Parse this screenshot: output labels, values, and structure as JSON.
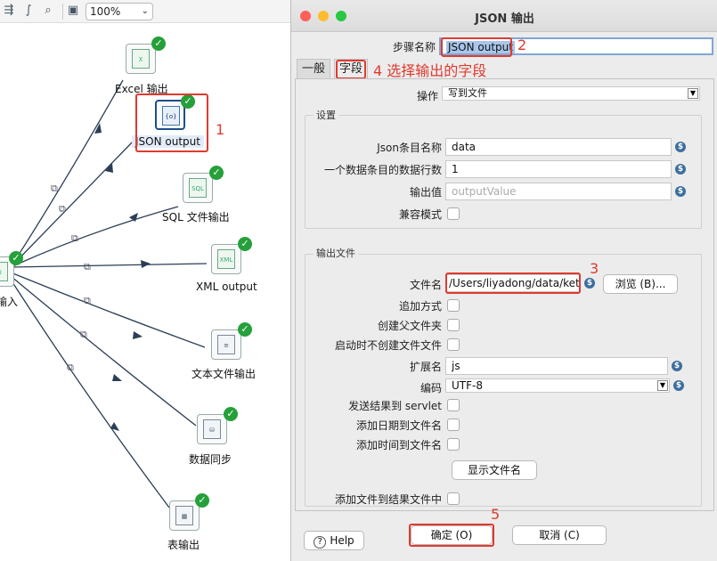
{
  "toolbar": {
    "zoom_value": "100%",
    "icons": [
      "flow-icon",
      "curve-icon",
      "zoom-fit-icon",
      "grid-icon"
    ]
  },
  "canvas": {
    "source_label": "输入",
    "steps": [
      {
        "id": "excel",
        "label": "Excel 输出",
        "icon": "excel-file-icon"
      },
      {
        "id": "json",
        "label": "JSON output",
        "icon": "json-file-icon"
      },
      {
        "id": "sql",
        "label": "SQL 文件输出",
        "icon": "sql-file-icon"
      },
      {
        "id": "xml",
        "label": "XML output",
        "icon": "xml-file-icon"
      },
      {
        "id": "text",
        "label": "文本文件输出",
        "icon": "text-file-icon"
      },
      {
        "id": "sync",
        "label": "数据同步",
        "icon": "database-sync-icon"
      },
      {
        "id": "table",
        "label": "表输出",
        "icon": "table-icon"
      }
    ],
    "annotation_1": "1"
  },
  "dialog": {
    "title": "JSON 输出",
    "step_name_label": "步骤名称",
    "step_name_value": "JSON output",
    "annotation_2": "2",
    "tabs": [
      {
        "label": "一般",
        "active": false
      },
      {
        "label": "字段",
        "active": true
      }
    ],
    "annotation_4": "4 选择输出的字段",
    "operation_label": "操作",
    "operation_value": "写到文件",
    "settings": {
      "group_title": "设置",
      "json_block_label": "Json条目名称",
      "json_block_value": "data",
      "rows_per_block_label": "一个数据条目的数据行数",
      "rows_per_block_value": "1",
      "output_value_label": "输出值",
      "output_value_placeholder": "outputValue",
      "compat_label": "兼容模式"
    },
    "output_file": {
      "group_title": "输出文件",
      "filename_label": "文件名",
      "filename_value": "/Users/liyadong/data/kettl",
      "annotation_3": "3",
      "browse_label": "浏览 (B)...",
      "append_label": "追加方式",
      "create_parent_label": "创建父文件夹",
      "no_create_on_start_label": "启动时不创建文件文件",
      "extension_label": "扩展名",
      "extension_value": "js",
      "encoding_label": "编码",
      "encoding_value": "UTF-8",
      "send_result_label": "发送结果到 servlet",
      "add_date_label": "添加日期到文件名",
      "add_time_label": "添加时间到文件名",
      "show_filename_label": "显示文件名",
      "add_to_result_label": "添加文件到结果文件中"
    },
    "footer": {
      "help_label": "Help",
      "ok_label": "确定 (O)",
      "cancel_label": "取消 (C)",
      "annotation_5": "5"
    }
  },
  "colors": {
    "annotation_red": "#e03a2f",
    "ok_green": "#25a03a",
    "selection_blue": "#a9c6ea",
    "variable_icon": "#3c6e9e"
  }
}
